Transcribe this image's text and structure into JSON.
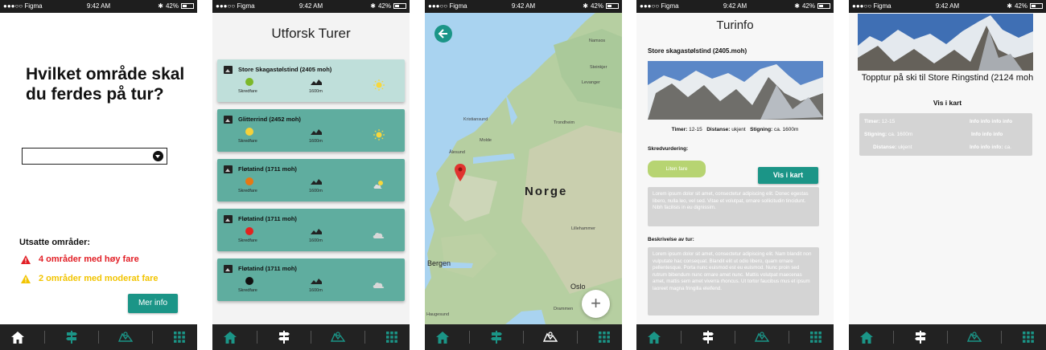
{
  "status_bar": {
    "carrier": "●●●○○ Figma",
    "time": "9:42 AM",
    "battery": "42%"
  },
  "colors": {
    "accent": "#1b9587",
    "danger": "#e21f26",
    "warning": "#f2c400",
    "nav_bg": "#222222"
  },
  "nav_icons": [
    "home-icon",
    "signpost-icon",
    "map-icon",
    "grid-icon"
  ],
  "screen1": {
    "question": "Hvilket område skal du ferdes på tur?",
    "exposed_title": "Utsatte områder:",
    "high_danger": "4 områder med høy fare",
    "moderate_danger": "2 områder med moderat fare",
    "more_button": "Mer info"
  },
  "screen2": {
    "title": "Utforsk Turer",
    "tours": [
      {
        "name": "Store Skagastølstind  (2405 moh)",
        "danger_label": "Skredfare",
        "danger_color": "#7cb82a",
        "height": "1600m",
        "weather": "sun"
      },
      {
        "name": "Glitterrind (2452 moh)",
        "danger_label": "Skredfare",
        "danger_color": "#f5d13a",
        "height": "1600m",
        "weather": "sun"
      },
      {
        "name": "Fløtatind (1711 moh)",
        "danger_label": "Skredfare",
        "danger_color": "#e67814",
        "height": "1600m",
        "weather": "partly-cloudy"
      },
      {
        "name": "Fløtatind (1711 moh)",
        "danger_label": "Skredfare",
        "danger_color": "#e2231f",
        "height": "1600m",
        "weather": "cloud"
      },
      {
        "name": "Fløtatind (1711 moh)",
        "danger_label": "Skredfare",
        "danger_color": "#111111",
        "height": "1600m",
        "weather": "cloud"
      }
    ]
  },
  "screen3": {
    "country_label": "Norge",
    "cities": [
      "Namsos",
      "Steinkjer",
      "Levanger",
      "Trondheim",
      "Kristiansund",
      "Molde",
      "Ålesund",
      "Lillehammer",
      "Bergen",
      "Oslo",
      "Drammen",
      "Haugesund"
    ],
    "zoom_button": "+"
  },
  "screen4": {
    "title": "Turinfo",
    "peak": "Store skagastølstind (2405.moh)",
    "hours_label": "Timer:",
    "hours_value": "12-15",
    "distance_label": "Distanse:",
    "distance_value": "ukjent",
    "climb_label": "Stigning:",
    "climb_value": "ca. 1600m",
    "avalanche_label": "Skredvurdering:",
    "danger_pill": "Liten fare",
    "map_button": "Vis i kart",
    "summary": "Lorem ipsum dolor sit amet, consectetur adipiscing elit. Donec egestas libero, nulla leo, vel sed. Vitae et volutpat, ornare sollicitudin tincidunt. Nibh facilisis in eu dignissim.",
    "description_label": "Beskrivelse av tur:",
    "description": "Lorem ipsum dolor sit amet, consectetur adipiscing elit. Nam blandit non vulputate hac consequat. Blandit elit ut odio libero, quam ornare pellentesque. Porta nunc euismod est eu euismod. Nunc proin sed rutrum bibendum nunc ornare amet nunc. Mattis volutpat maecenas amet, mattis sem amet viverra rhoncus. Ut tortor faucibus mus et ipsum laoreet magna fringilla eleifend."
  },
  "screen5": {
    "title": "Topptur på ski til Store Ringstind (2124 moh",
    "map_link": "Vis i kart",
    "rows": [
      {
        "label": "Timer:",
        "value": "12-15",
        "info": "Info info info info"
      },
      {
        "label": "Stigning:",
        "value": "ca. 1600m",
        "info": "Info info info"
      },
      {
        "label": "Distanse:",
        "value": "ukjent",
        "info": "Info info info:",
        "info_value": "ca."
      }
    ]
  }
}
